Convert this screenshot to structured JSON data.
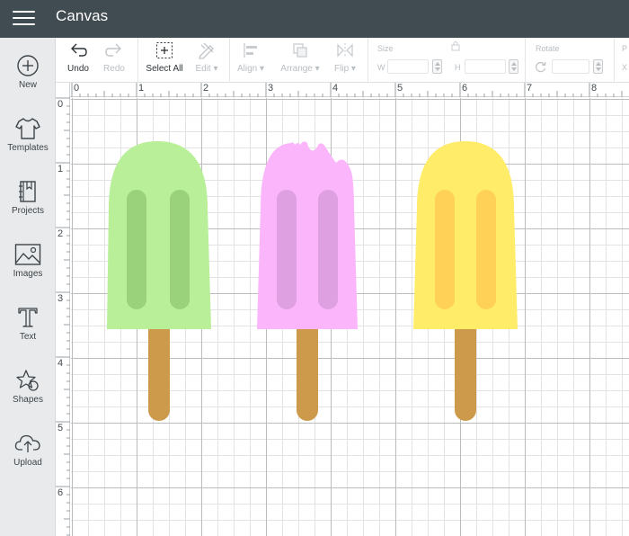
{
  "app": {
    "title": "Canvas"
  },
  "sidebar": {
    "items": [
      {
        "label": "New",
        "icon": "plus-circle-icon"
      },
      {
        "label": "Templates",
        "icon": "tshirt-icon"
      },
      {
        "label": "Projects",
        "icon": "bookmark-book-icon"
      },
      {
        "label": "Images",
        "icon": "image-icon"
      },
      {
        "label": "Text",
        "icon": "text-t-icon"
      },
      {
        "label": "Shapes",
        "icon": "shapes-icon"
      },
      {
        "label": "Upload",
        "icon": "cloud-upload-icon"
      }
    ]
  },
  "toolbar": {
    "undo": "Undo",
    "redo": "Redo",
    "select_all": "Select All",
    "edit": "Edit",
    "align": "Align",
    "arrange": "Arrange",
    "flip": "Flip",
    "size": "Size",
    "w": "W",
    "h": "H",
    "rotate": "Rotate",
    "p": "P",
    "x": "X"
  },
  "rulers": {
    "top": [
      "0",
      "1",
      "2",
      "3",
      "4",
      "5",
      "6",
      "7",
      "8"
    ],
    "left": [
      "0",
      "1",
      "2",
      "3",
      "4",
      "5",
      "6"
    ]
  },
  "canvas": {
    "objects": [
      {
        "name": "green-popsicle",
        "color": "#b8ef98",
        "stripe": "#99d27a"
      },
      {
        "name": "pink-popsicle",
        "color": "#fbb5fb",
        "stripe": "#dea0e0"
      },
      {
        "name": "yellow-popsicle",
        "color": "#ffec69",
        "stripe": "#ffd257"
      }
    ],
    "stick_color": "#cc9a4a"
  }
}
